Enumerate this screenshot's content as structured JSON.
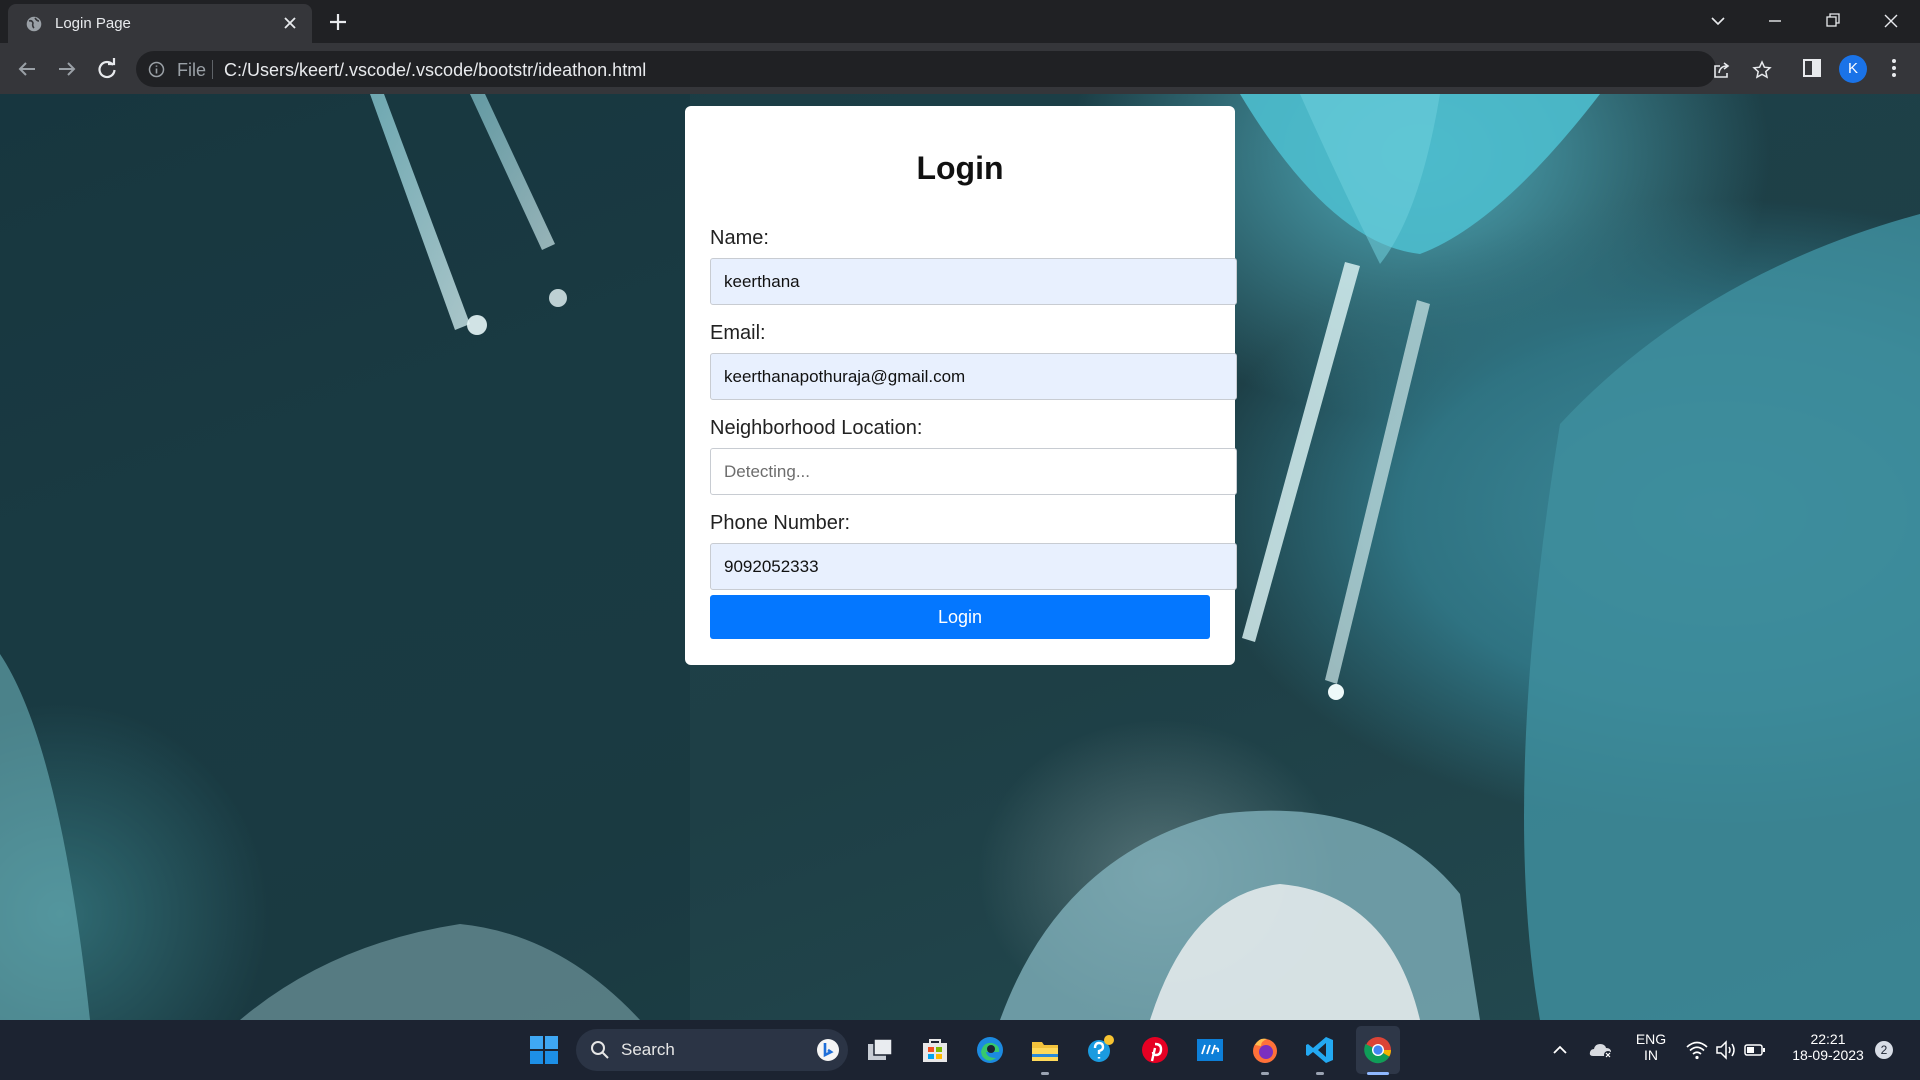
{
  "browser": {
    "tab_title": "Login Page",
    "address_scheme": "File",
    "address_url": "C:/Users/keert/.vscode/.vscode/bootstr/ideathon.html",
    "profile_initial": "K"
  },
  "page": {
    "heading": "Login",
    "fields": {
      "name": {
        "label": "Name:",
        "value": "keerthana"
      },
      "email": {
        "label": "Email:",
        "value": "keerthanapothuraja@gmail.com"
      },
      "location": {
        "label": "Neighborhood Location:",
        "placeholder": "Detecting..."
      },
      "phone": {
        "label": "Phone Number:",
        "value": "9092052333"
      }
    },
    "submit_label": "Login"
  },
  "taskbar": {
    "search_label": "Search",
    "language": "ENG",
    "region": "IN",
    "time": "22:21",
    "date": "18-09-2023",
    "notification_count": "2"
  },
  "colors": {
    "accent_button": "#0477ff",
    "autofill_input": "#e8f0fe",
    "browser_frame": "#202124",
    "taskbar": "#1c2331"
  }
}
